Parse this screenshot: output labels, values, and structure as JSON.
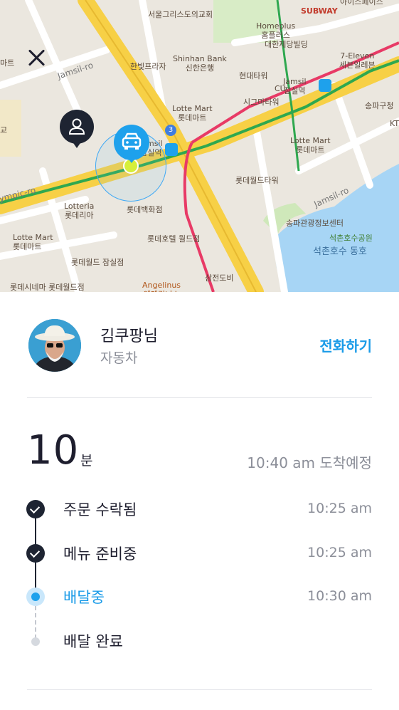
{
  "map": {
    "road_labels": [
      "Jamsil-ro",
      "ympic-ro",
      "Jamsil-ro"
    ],
    "route_badge": "3",
    "pois": [
      {
        "name": "서울그리스도의교회"
      },
      {
        "name": "SUBWAY"
      },
      {
        "name": "Homeplus\n홈플러스"
      },
      {
        "name": "대한제당빌딩"
      },
      {
        "name": "7-Eleven\n세븐일레븐"
      },
      {
        "name": "마트"
      },
      {
        "name": "한빛프라자"
      },
      {
        "name": "Shinhan Bank\n신한은행"
      },
      {
        "name": "현대타워"
      },
      {
        "name": "Jamsil\n잠실역"
      },
      {
        "name": "CU"
      },
      {
        "name": "시그마타워"
      },
      {
        "name": "송파구청"
      },
      {
        "name": "Lotte Mart\n롯데마트"
      },
      {
        "name": "교"
      },
      {
        "name": "Jamsil\n잠실역"
      },
      {
        "name": "Lotte Mart\n롯데마트"
      },
      {
        "name": "롯데월드타워"
      },
      {
        "name": "Lotteria\n롯데리아"
      },
      {
        "name": "롯데백화점"
      },
      {
        "name": "송파관광정보센터"
      },
      {
        "name": "석촌호수공원"
      },
      {
        "name": "석촌호수 동호"
      },
      {
        "name": "Lotte Mart\n롯데마트"
      },
      {
        "name": "롯데호텔 월드점"
      },
      {
        "name": "롯데월드 잠실점"
      },
      {
        "name": "삼전도비"
      },
      {
        "name": "롯데시네마 롯데월드점"
      },
      {
        "name": "Angelinus\n엔제리너스"
      },
      {
        "name": "KT"
      },
      {
        "name": "아이스페이스"
      }
    ]
  },
  "driver": {
    "name": "김쿠팡님",
    "vehicle": "자동차",
    "call_label": "전화하기"
  },
  "eta": {
    "minutes": "10",
    "unit": "분",
    "arrival": "10:40 am 도착예정"
  },
  "steps": [
    {
      "label": "주문 수락됨",
      "time": "10:25 am",
      "state": "done"
    },
    {
      "label": "메뉴 준비중",
      "time": "10:25 am",
      "state": "done"
    },
    {
      "label": "배달중",
      "time": "10:30 am",
      "state": "active"
    },
    {
      "label": "배달 완료",
      "time": "",
      "state": "pending"
    }
  ],
  "colors": {
    "accent": "#1a9be8",
    "dark": "#1e2432",
    "muted": "#8c8f99"
  }
}
